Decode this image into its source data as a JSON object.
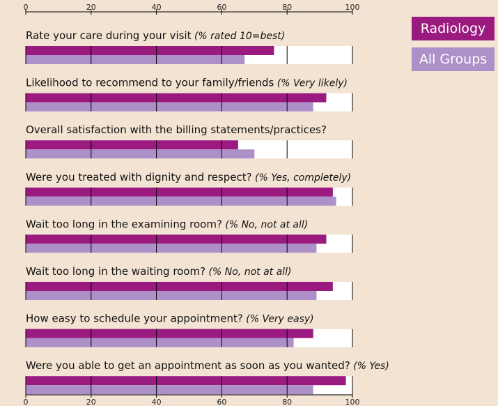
{
  "colors": {
    "background": "#f2e3d2",
    "radiology": "#9b1a80",
    "all_groups": "#ae90c8",
    "track": "#ffffff",
    "lines": "#000000"
  },
  "chart_data": {
    "type": "bar",
    "orientation": "horizontal",
    "xlim": [
      0,
      100
    ],
    "ticks": [
      0,
      20,
      40,
      60,
      80,
      100
    ],
    "tick_labels": [
      "0",
      "20",
      "40",
      "60",
      "80",
      "100"
    ],
    "legend": [
      "Radiology",
      "All Groups"
    ],
    "legend_placement": "top-right",
    "categories": [
      {
        "text": "Rate your care during your visit",
        "qualifier": "(% rated 10=best)"
      },
      {
        "text": "Likelihood to recommend to your family/friends",
        "qualifier": "(% Very likely)"
      },
      {
        "text": "Overall satisfaction with the billing statements/practices?",
        "qualifier": ""
      },
      {
        "text": "Were you treated with dignity and respect?",
        "qualifier": "(% Yes, completely)"
      },
      {
        "text": "Wait too long in the examining room?",
        "qualifier": "(% No, not at all)"
      },
      {
        "text": "Wait too long in the waiting room?",
        "qualifier": "(% No, not at all)"
      },
      {
        "text": "How easy to schedule your appointment?",
        "qualifier": "(% Very easy)"
      },
      {
        "text": "Were you able to get an appointment as soon as you wanted?",
        "qualifier": "(% Yes)"
      }
    ],
    "series": [
      {
        "name": "Radiology",
        "values": [
          76,
          92,
          65,
          94,
          92,
          94,
          88,
          98
        ]
      },
      {
        "name": "All Groups",
        "values": [
          67,
          88,
          70,
          95,
          89,
          89,
          82,
          88
        ]
      }
    ]
  }
}
